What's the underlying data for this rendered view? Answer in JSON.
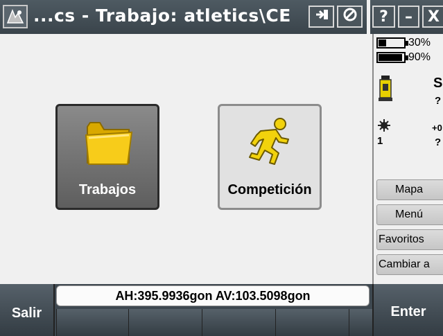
{
  "window": {
    "title": "...cs - Trabajo: atletics\\CE",
    "icons": [
      "app-menu-icon",
      "back-icon",
      "clear-icon"
    ],
    "help_label": "?",
    "minimize_label": "–",
    "close_label": "X"
  },
  "tiles": [
    {
      "label": "Trabajos",
      "icon": "folder-icon"
    },
    {
      "label": "Competición",
      "icon": "running-man-icon"
    }
  ],
  "status": {
    "battery_1": "30%",
    "battery_1_level": 0.3,
    "battery_2": "90%",
    "battery_2_level": 0.9,
    "instrument_letter": "S",
    "instrument_value": "?",
    "target_value": "+0",
    "target_number": "1",
    "target_sub": "?"
  },
  "side_buttons": [
    "Mapa",
    "Menú",
    "Favoritos",
    "Cambiar a"
  ],
  "bottom": {
    "exit_label": "Salir",
    "enter_label": "Enter",
    "angles": "AH:395.9936gon  AV:103.5098gon"
  },
  "colors": {
    "titlebar": "#3e4850",
    "folder": "#f5c400",
    "runner": "#e6c200"
  }
}
